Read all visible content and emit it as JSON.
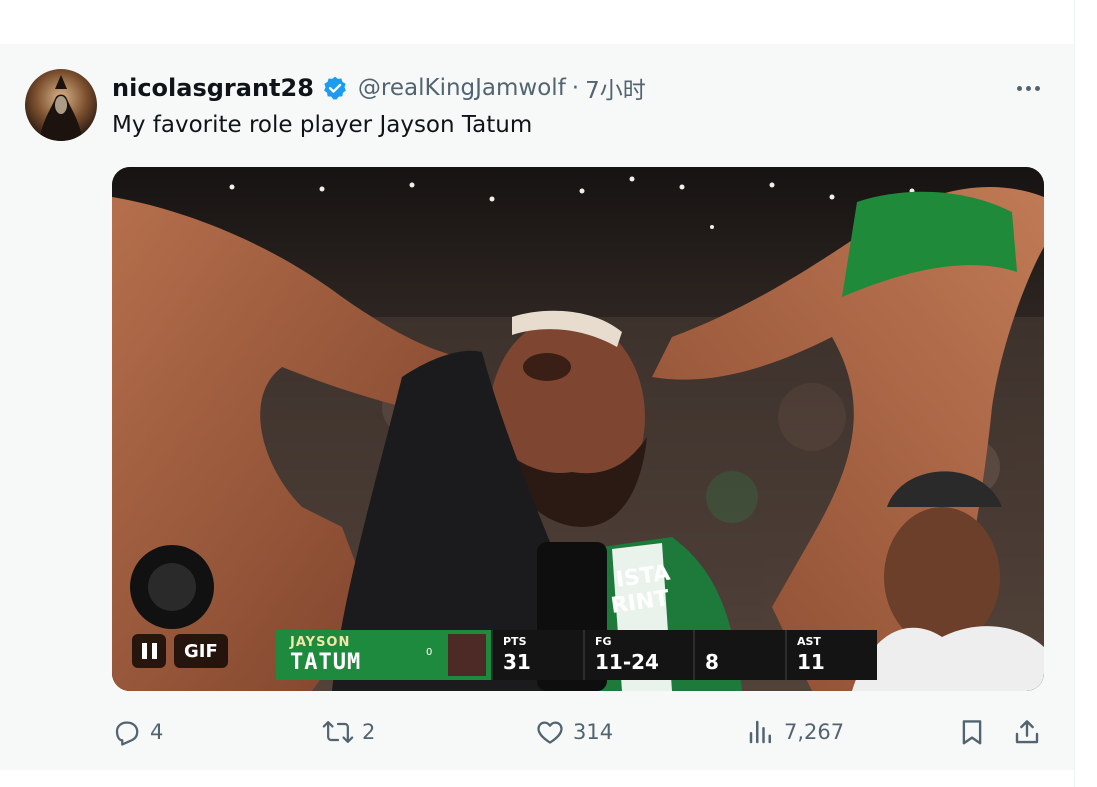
{
  "tweet": {
    "display_name": "nicolasgrant28",
    "handle": "@realKingJamwolf",
    "separator": "·",
    "time": "7小时",
    "text": "My favorite role player Jayson Tatum"
  },
  "media": {
    "gif_badge": "GIF",
    "scorebug": {
      "first_name": "JAYSON",
      "last_name": "TATUM",
      "jersey": "0",
      "stats": [
        {
          "label": "PTS",
          "value": "31"
        },
        {
          "label": "FG",
          "value": "11-24"
        },
        {
          "label": "",
          "value": "8"
        },
        {
          "label": "AST",
          "value": "11"
        }
      ]
    },
    "jersey_text": "ISTA\nRINT"
  },
  "actions": {
    "replies": "4",
    "reposts": "2",
    "likes": "314",
    "views": "7,267"
  },
  "icons": [
    "verified-badge-icon",
    "more-icon",
    "pause-icon",
    "reply-icon",
    "repost-icon",
    "like-icon",
    "views-icon",
    "bookmark-icon",
    "share-icon"
  ],
  "colors": {
    "verified": "#1d9bf0",
    "muted_text": "#536471",
    "scorebug_green": "#1e8a3e",
    "tweet_background": "#f7f9f9"
  }
}
